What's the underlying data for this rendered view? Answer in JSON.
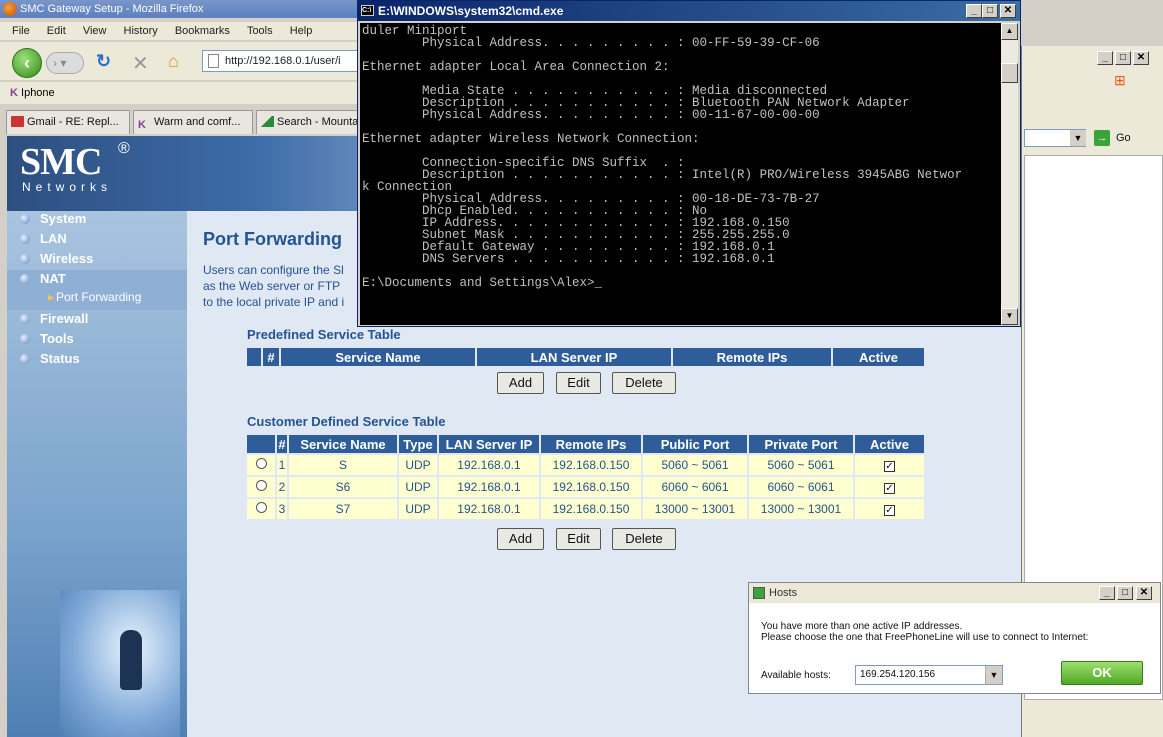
{
  "firefox": {
    "title": "SMC Gateway Setup - Mozilla Firefox",
    "menu": [
      "File",
      "Edit",
      "View",
      "History",
      "Bookmarks",
      "Tools",
      "Help"
    ],
    "url": "http://192.168.0.1/user/i",
    "bookmark": "Iphone",
    "tabs": [
      "Gmail - RE: Repl...",
      "Warm and comf...",
      "Search - Mounta"
    ]
  },
  "smc": {
    "logo": "SMC",
    "reg": "®",
    "tagline": "Networks",
    "nav": [
      "System",
      "LAN",
      "Wireless",
      "NAT",
      "Firewall",
      "Tools",
      "Status"
    ],
    "sub_item": "Port Forwarding"
  },
  "page": {
    "title": "Port Forwarding",
    "desc": [
      "Users can configure the Sl",
      "as the Web server or FTP",
      "to the local private IP and i"
    ],
    "predefined_title": "Predefined Service Table",
    "predefined_headers": [
      "#",
      "Service Name",
      "LAN Server IP",
      "Remote IPs",
      "Active"
    ],
    "customer_title": "Customer Defined Service Table",
    "customer_headers": [
      "#",
      "Service Name",
      "Type",
      "LAN Server IP",
      "Remote IPs",
      "Public Port",
      "Private Port",
      "Active"
    ],
    "rows": [
      {
        "n": "1",
        "name": "S",
        "type": "UDP",
        "lan": "192.168.0.1",
        "remote": "192.168.0.150",
        "pub": "5060 ~ 5061",
        "priv": "5060 ~ 5061",
        "active": "✓"
      },
      {
        "n": "2",
        "name": "S6",
        "type": "UDP",
        "lan": "192.168.0.1",
        "remote": "192.168.0.150",
        "pub": "6060 ~ 6061",
        "priv": "6060 ~ 6061",
        "active": "✓"
      },
      {
        "n": "3",
        "name": "S7",
        "type": "UDP",
        "lan": "192.168.0.1",
        "remote": "192.168.0.150",
        "pub": "13000 ~ 13001",
        "priv": "13000 ~ 13001",
        "active": "✓"
      }
    ],
    "buttons": {
      "add": "Add",
      "edit": "Edit",
      "delete": "Delete"
    }
  },
  "cmd": {
    "title": "E:\\WINDOWS\\system32\\cmd.exe",
    "icon": "C:\\",
    "lines": [
      "duler Miniport",
      "        Physical Address. . . . . . . . . : 00-FF-59-39-CF-06",
      "",
      "Ethernet adapter Local Area Connection 2:",
      "",
      "        Media State . . . . . . . . . . . : Media disconnected",
      "        Description . . . . . . . . . . . : Bluetooth PAN Network Adapter",
      "        Physical Address. . . . . . . . . : 00-11-67-00-00-00",
      "",
      "Ethernet adapter Wireless Network Connection:",
      "",
      "        Connection-specific DNS Suffix  . :",
      "        Description . . . . . . . . . . . : Intel(R) PRO/Wireless 3945ABG Networ",
      "k Connection",
      "        Physical Address. . . . . . . . . : 00-18-DE-73-7B-27",
      "        Dhcp Enabled. . . . . . . . . . . : No",
      "        IP Address. . . . . . . . . . . . : 192.168.0.150",
      "        Subnet Mask . . . . . . . . . . . : 255.255.255.0",
      "        Default Gateway . . . . . . . . . : 192.168.0.1",
      "        DNS Servers . . . . . . . . . . . : 192.168.0.1",
      "",
      "E:\\Documents and Settings\\Alex>_"
    ]
  },
  "bgwin": {
    "go_label": "Go"
  },
  "hosts": {
    "title": "Hosts",
    "message1": "You have more than one active IP addresses.",
    "message2": "Please choose the one that FreePhoneLine will use to connect to Internet:",
    "label": "Available hosts:",
    "selected": "169.254.120.156",
    "ok": "OK"
  }
}
